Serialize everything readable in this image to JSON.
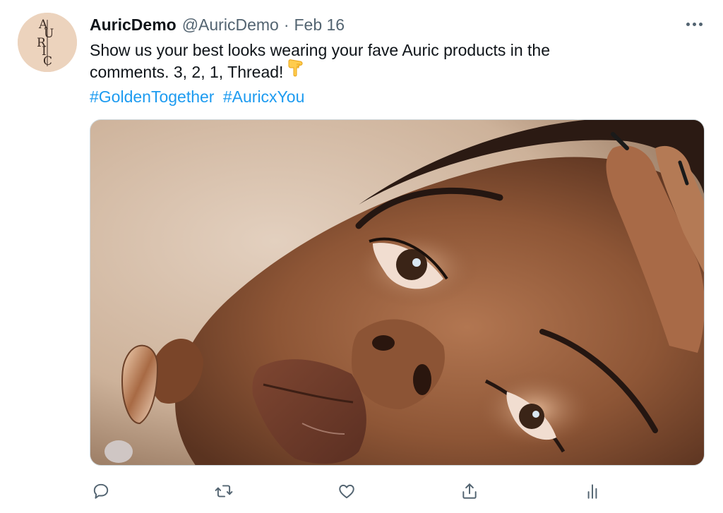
{
  "tweet": {
    "display_name": "AuricDemo",
    "handle": "@AuricDemo",
    "separator": "·",
    "date": "Feb 16",
    "text_line1": "Show us your best looks wearing your fave Auric products in the",
    "text_line2": "comments. 3, 2, 1, Thread!",
    "emoji": "backhand-index-pointing-down",
    "hashtags": [
      "#GoldenTogether",
      "#AuricxYou"
    ],
    "media_description": "",
    "avatar_logo_letters": "AURIC"
  },
  "icons": {
    "more": "more-horizontal-icon",
    "reply": "reply-icon",
    "retweet": "retweet-icon",
    "like": "heart-icon",
    "share": "share-icon",
    "analytics": "analytics-icon"
  },
  "colors": {
    "link": "#1d9bf0",
    "secondary_text": "#536471",
    "avatar_bg": "#ecd3bd"
  }
}
